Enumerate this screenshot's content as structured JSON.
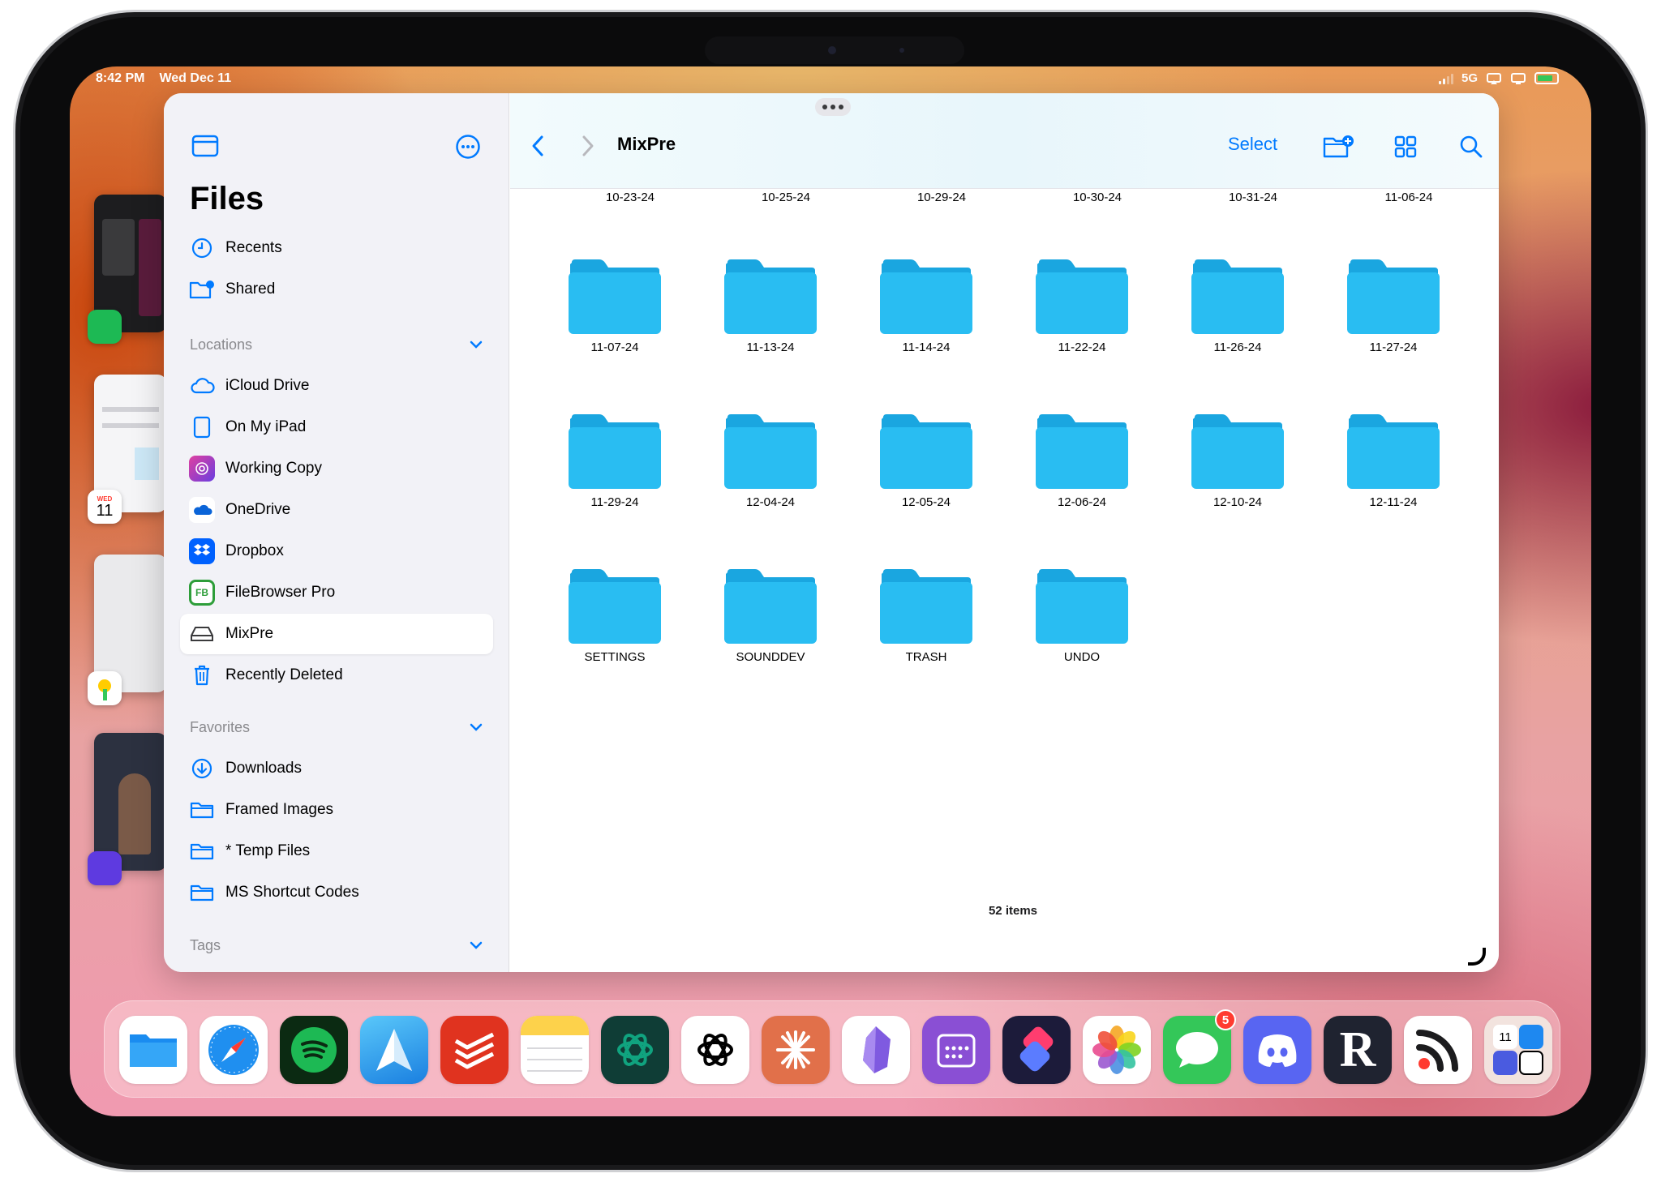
{
  "status": {
    "time": "8:42 PM",
    "date": "Wed Dec 11",
    "network": "5G"
  },
  "stage_manager": {
    "calendar_day_label": "WED",
    "calendar_day_number": "11"
  },
  "sidebar": {
    "title": "Files",
    "top_items": [
      {
        "label": "Recents",
        "icon": "clock-icon"
      },
      {
        "label": "Shared",
        "icon": "shared-folder-icon"
      }
    ],
    "locations_header": "Locations",
    "locations": [
      {
        "label": "iCloud Drive",
        "icon": "cloud-icon"
      },
      {
        "label": "On My iPad",
        "icon": "ipad-icon"
      },
      {
        "label": "Working Copy",
        "icon": "working-copy-icon"
      },
      {
        "label": "OneDrive",
        "icon": "onedrive-icon"
      },
      {
        "label": "Dropbox",
        "icon": "dropbox-icon"
      },
      {
        "label": "FileBrowser Pro",
        "icon": "filebrowser-icon"
      },
      {
        "label": "MixPre",
        "icon": "drive-icon",
        "selected": true
      },
      {
        "label": "Recently Deleted",
        "icon": "trash-icon"
      }
    ],
    "filebrowser_badge": "FB",
    "favorites_header": "Favorites",
    "favorites": [
      {
        "label": "Downloads",
        "icon": "download-icon"
      },
      {
        "label": "Framed Images",
        "icon": "folder-icon"
      },
      {
        "label": "* Temp Files",
        "icon": "folder-icon"
      },
      {
        "label": "MS Shortcut Codes",
        "icon": "folder-icon"
      }
    ],
    "tags_header": "Tags"
  },
  "toolbar": {
    "title": "MixPre",
    "select_label": "Select"
  },
  "folders": {
    "top_row_labels": [
      "10-23-24",
      "10-25-24",
      "10-29-24",
      "10-30-24",
      "10-31-24",
      "11-06-24"
    ],
    "row1": [
      "11-07-24",
      "11-13-24",
      "11-14-24",
      "11-22-24",
      "11-26-24",
      "11-27-24"
    ],
    "row2": [
      "11-29-24",
      "12-04-24",
      "12-05-24",
      "12-06-24",
      "12-10-24",
      "12-11-24"
    ],
    "row3": [
      "SETTINGS",
      "SOUNDDEV",
      "TRASH",
      "UNDO"
    ]
  },
  "item_count": "52 items",
  "colors": {
    "accent": "#007aff",
    "folder": "#29bdf2",
    "folder_tab": "#1aa6e0"
  },
  "dock": {
    "apps": [
      "files",
      "safari",
      "spotify",
      "spark",
      "todoist",
      "notes",
      "chatgpt-dark",
      "chatgpt",
      "claude",
      "obsidian",
      "fantastical",
      "shortcuts",
      "photos",
      "messages",
      "discord",
      "readwise-reader",
      "rss",
      "folder-stack"
    ],
    "messages_badge": "5",
    "reader_glyph": "R",
    "stack_glyph": "11"
  }
}
